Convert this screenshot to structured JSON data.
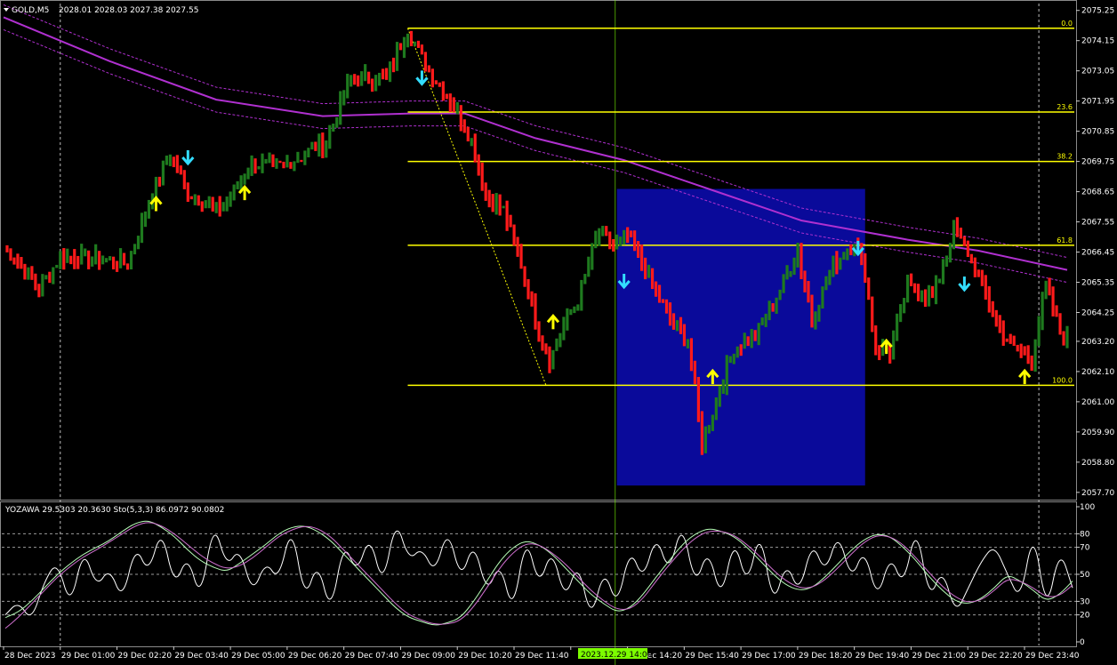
{
  "header": {
    "symbol_label": "GOLD,M5",
    "ohlc": "2028.01 2028.03 2027.38 2027.55"
  },
  "indicator_header": {
    "text": "YOZAWA 29.5303 20.3630  Sto(5,3,3) 86.0972 90.0802"
  },
  "colors": {
    "background": "#000000",
    "bull": "#1e7a1e",
    "bear": "#ff1a1a",
    "fib": "#ffff00",
    "ma": "#b030d0",
    "box": "#0a0a9a",
    "crosshair": "#7cfc00",
    "arrow_up": "#ffff00",
    "arrow_down": "#33ddff"
  },
  "crosshair_time_label": "2023.12.29 14:00",
  "chart_data": [
    {
      "type": "candlestick",
      "price_axis_labels": [
        "2075.25",
        "2074.15",
        "2073.05",
        "2071.95",
        "2070.85",
        "2069.75",
        "2068.65",
        "2067.55",
        "2066.45",
        "2065.35",
        "2064.25",
        "2063.20",
        "2062.10",
        "2061.00",
        "2059.90",
        "2058.80",
        "2057.70"
      ],
      "ylim": [
        2057.5,
        2075.5
      ],
      "time_axis_labels": [
        "28 Dec 2023",
        "29 Dec 01:00",
        "29 Dec 02:20",
        "29 Dec 03:40",
        "29 Dec 05:00",
        "29 Dec 06:20",
        "29 Dec 07:40",
        "29 Dec 09:00",
        "29 Dec 10:20",
        "29 Dec 11:40",
        "29 Dec 13:00",
        "29 Dec 14:20",
        "29 Dec 15:40",
        "29 Dec 17:00",
        "29 Dec 18:20",
        "29 Dec 19:40",
        "29 Dec 21:00",
        "29 Dec 22:20",
        "29 Dec 23:40"
      ],
      "close_keypoints": [
        [
          0,
          2066.6
        ],
        [
          5,
          2066.0
        ],
        [
          10,
          2065.1
        ],
        [
          16,
          2066.3
        ],
        [
          26,
          2066.2
        ],
        [
          35,
          2066.0
        ],
        [
          42,
          2068.6
        ],
        [
          47,
          2070.0
        ],
        [
          52,
          2068.6
        ],
        [
          60,
          2068.0
        ],
        [
          65,
          2068.6
        ],
        [
          70,
          2069.7
        ],
        [
          76,
          2069.5
        ],
        [
          82,
          2069.8
        ],
        [
          91,
          2070.5
        ],
        [
          98,
          2072.8
        ],
        [
          108,
          2072.8
        ],
        [
          114,
          2074.6
        ],
        [
          118,
          2073.5
        ],
        [
          124,
          2072.3
        ],
        [
          128,
          2071.6
        ],
        [
          132,
          2070.5
        ],
        [
          136,
          2068.5
        ],
        [
          141,
          2068.0
        ],
        [
          146,
          2066.0
        ],
        [
          150,
          2064.0
        ],
        [
          154,
          2062.5
        ],
        [
          158,
          2063.8
        ],
        [
          162,
          2064.7
        ],
        [
          168,
          2067.3
        ],
        [
          172,
          2066.6
        ],
        [
          176,
          2067.0
        ],
        [
          182,
          2065.5
        ],
        [
          188,
          2064.0
        ],
        [
          193,
          2063.3
        ],
        [
          197,
          2059.5
        ],
        [
          202,
          2061.4
        ],
        [
          206,
          2063.0
        ],
        [
          212,
          2063.4
        ],
        [
          218,
          2064.8
        ],
        [
          224,
          2066.5
        ],
        [
          228,
          2064.0
        ],
        [
          234,
          2066.0
        ],
        [
          240,
          2066.9
        ],
        [
          243,
          2065.6
        ],
        [
          246,
          2063.0
        ],
        [
          250,
          2062.8
        ],
        [
          255,
          2065.2
        ],
        [
          262,
          2064.8
        ],
        [
          268,
          2067.2
        ],
        [
          274,
          2066.0
        ],
        [
          278,
          2064.5
        ],
        [
          284,
          2063.0
        ],
        [
          290,
          2062.6
        ],
        [
          294,
          2065.2
        ],
        [
          298,
          2063.6
        ],
        [
          300,
          2063.3
        ]
      ],
      "fibonacci": {
        "levels": [
          {
            "label": "0.0",
            "price": 2074.6
          },
          {
            "label": "23.6",
            "price": 2071.55
          },
          {
            "label": "38.2",
            "price": 2069.75
          },
          {
            "label": "61.8",
            "price": 2066.7
          },
          {
            "label": "100.0",
            "price": 2061.6
          }
        ]
      },
      "highlight_box": {
        "price_top": 2068.75,
        "price_bottom": 2057.95
      },
      "moving_average": [
        [
          0,
          2075.0
        ],
        [
          30,
          2073.4
        ],
        [
          60,
          2072.0
        ],
        [
          90,
          2071.4
        ],
        [
          115,
          2071.5
        ],
        [
          130,
          2071.5
        ],
        [
          150,
          2070.6
        ],
        [
          175,
          2069.8
        ],
        [
          200,
          2068.7
        ],
        [
          225,
          2067.6
        ],
        [
          255,
          2066.9
        ],
        [
          275,
          2066.5
        ],
        [
          300,
          2065.8
        ]
      ],
      "signals": [
        {
          "type": "buy",
          "bar": 43,
          "price": 2068.2
        },
        {
          "type": "sell",
          "bar": 52,
          "price": 2069.9
        },
        {
          "type": "buy",
          "bar": 68,
          "price": 2068.6
        },
        {
          "type": "sell",
          "bar": 118,
          "price": 2072.8
        },
        {
          "type": "buy",
          "bar": 155,
          "price": 2063.9
        },
        {
          "type": "sell",
          "bar": 175,
          "price": 2065.4
        },
        {
          "type": "buy",
          "bar": 200,
          "price": 2061.9
        },
        {
          "type": "sell",
          "bar": 241,
          "price": 2066.6
        },
        {
          "type": "buy",
          "bar": 249,
          "price": 2063.0
        },
        {
          "type": "sell",
          "bar": 271,
          "price": 2065.3
        },
        {
          "type": "buy",
          "bar": 288,
          "price": 2061.9
        }
      ]
    },
    {
      "type": "line",
      "axis_labels": [
        "100",
        "80",
        "70",
        "50",
        "30",
        "20",
        "0"
      ],
      "ylim": [
        0,
        100
      ],
      "grid_levels": [
        80,
        70,
        50,
        30,
        20
      ],
      "series": [
        {
          "color": "#ffffff",
          "values": [
            20,
            30,
            15,
            45,
            60,
            25,
            70,
            40,
            55,
            30,
            72,
            50,
            85,
            40,
            65,
            30,
            90,
            55,
            70,
            35,
            60,
            45,
            88,
            30,
            60,
            20,
            75,
            50,
            80,
            40,
            92,
            60,
            70,
            50,
            85,
            45,
            75,
            35,
            60,
            20,
            80,
            40,
            70,
            30,
            60,
            15,
            55,
            25,
            70,
            45,
            80,
            50,
            90,
            40,
            70,
            30,
            78,
            40,
            85,
            25,
            60,
            35,
            75,
            50,
            82,
            45,
            70,
            30,
            65,
            40,
            88,
            30,
            55,
            20,
            40,
            60,
            72,
            50,
            30,
            85,
            20,
            70,
            40
          ]
        },
        {
          "color": "#b8ffb8",
          "values": [
            18,
            22,
            30,
            40,
            50,
            58,
            65,
            70,
            75,
            82,
            88,
            90,
            85,
            78,
            68,
            60,
            55,
            52,
            58,
            65,
            72,
            80,
            85,
            86,
            82,
            75,
            65,
            55,
            45,
            35,
            25,
            18,
            15,
            12,
            14,
            18,
            30,
            45,
            60,
            70,
            75,
            72,
            65,
            55,
            45,
            35,
            28,
            22,
            25,
            35,
            48,
            60,
            72,
            80,
            84,
            82,
            78,
            70,
            60,
            50,
            42,
            38,
            40,
            48,
            58,
            68,
            76,
            80,
            78,
            70,
            60,
            48,
            38,
            30,
            28,
            32,
            40,
            50,
            45,
            38,
            30,
            35,
            45
          ]
        },
        {
          "color": "#d070d0",
          "values": [
            10,
            18,
            28,
            38,
            48,
            56,
            63,
            68,
            74,
            80,
            86,
            89,
            86,
            80,
            72,
            64,
            58,
            54,
            56,
            62,
            70,
            78,
            83,
            86,
            84,
            78,
            68,
            58,
            48,
            38,
            28,
            20,
            16,
            13,
            13,
            16,
            26,
            40,
            55,
            66,
            73,
            72,
            66,
            58,
            48,
            38,
            30,
            24,
            24,
            32,
            45,
            57,
            68,
            77,
            82,
            82,
            79,
            72,
            63,
            53,
            45,
            40,
            40,
            46,
            55,
            65,
            74,
            79,
            78,
            72,
            62,
            51,
            41,
            33,
            29,
            31,
            38,
            47,
            45,
            40,
            33,
            34,
            42
          ]
        }
      ]
    }
  ]
}
